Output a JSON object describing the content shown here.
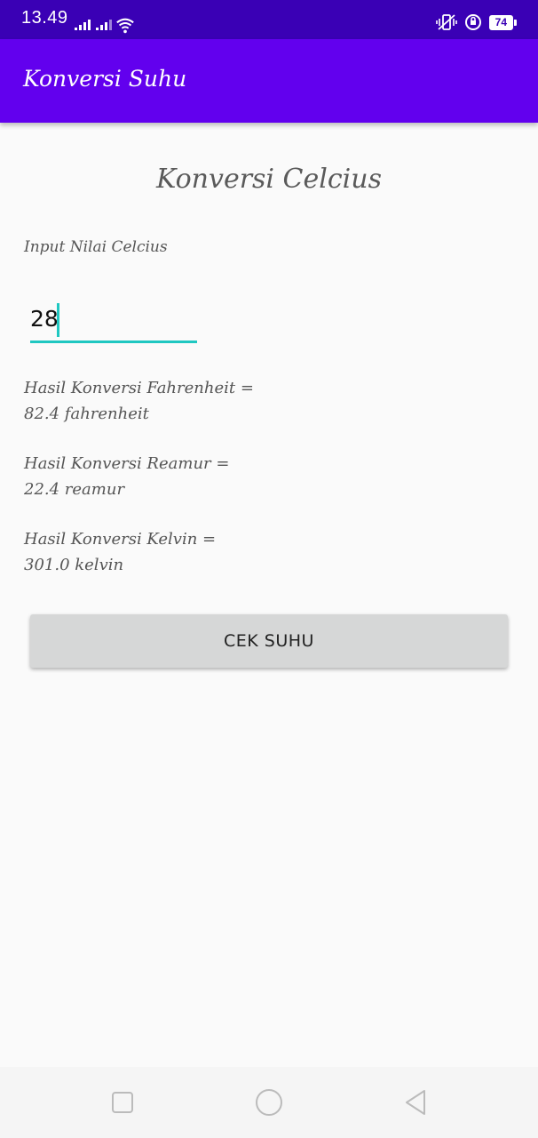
{
  "status_bar": {
    "time": "13.49",
    "battery": "74"
  },
  "app_bar": {
    "title": "Konversi Suhu"
  },
  "main": {
    "heading": "Konversi Celcius",
    "input_label": "Input Nilai Celcius",
    "celcius_value": "28",
    "results": [
      {
        "label": "Hasil Konversi Fahrenheit =",
        "value": "82.4 fahrenheit"
      },
      {
        "label": "Hasil Konversi Reamur =",
        "value": "22.4 reamur"
      },
      {
        "label": "Hasil Konversi Kelvin =",
        "value": "301.0 kelvin"
      }
    ],
    "button_label": "CEK SUHU"
  },
  "colors": {
    "status_bar": "#3a00b5",
    "app_bar": "#6200ee",
    "field_accent": "#1fc7c1",
    "button_bg": "#d6d7d7"
  },
  "icons": [
    "signal-icon",
    "wifi-icon",
    "vibrate-icon",
    "alarm-icon",
    "battery-icon",
    "recents-icon",
    "home-icon",
    "back-icon"
  ]
}
